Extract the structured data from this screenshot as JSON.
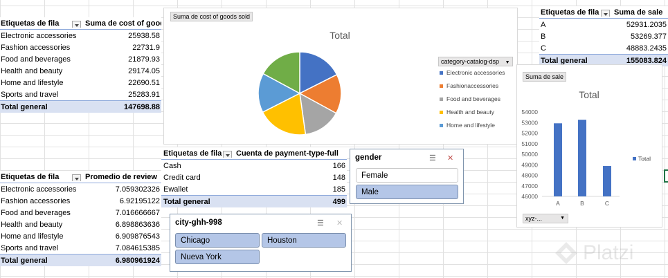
{
  "pivot_cost": {
    "header_row": "Etiquetas de fila",
    "header_value": "Suma de cost of goods",
    "rows": [
      {
        "label": "Electronic accessories",
        "value": "25938.58"
      },
      {
        "label": "Fashion accessories",
        "value": "22731.9"
      },
      {
        "label": "Food and beverages",
        "value": "21879.93"
      },
      {
        "label": "Health and beauty",
        "value": "29174.05"
      },
      {
        "label": "Home and lifestyle",
        "value": "22690.51"
      },
      {
        "label": "Sports and travel",
        "value": "25283.91"
      }
    ],
    "total_label": "Total general",
    "total_value": "147698.88"
  },
  "pivot_review": {
    "header_row": "Etiquetas de fila",
    "header_value": "Promedio de review",
    "rows": [
      {
        "label": "Electronic accessories",
        "value": "7.059302326"
      },
      {
        "label": "Fashion accessories",
        "value": "6.92195122"
      },
      {
        "label": "Food and beverages",
        "value": "7.016666667"
      },
      {
        "label": "Health and beauty",
        "value": "6.898863636"
      },
      {
        "label": "Home and lifestyle",
        "value": "6.909876543"
      },
      {
        "label": "Sports and travel",
        "value": "7.084615385"
      }
    ],
    "total_label": "Total general",
    "total_value": "6.980961924"
  },
  "pivot_payment": {
    "header_row": "Etiquetas de fila",
    "header_value": "Cuenta de payment-type-full",
    "rows": [
      {
        "label": "Cash",
        "value": "166"
      },
      {
        "label": "Credit card",
        "value": "148"
      },
      {
        "label": "Ewallet",
        "value": "185"
      }
    ],
    "total_label": "Total general",
    "total_value": "499"
  },
  "pivot_sales": {
    "header_row": "Etiquetas de fila",
    "header_value": "Suma de sale",
    "rows": [
      {
        "label": "A",
        "value": "52931.2035"
      },
      {
        "label": "B",
        "value": "53269.377"
      },
      {
        "label": "C",
        "value": "48883.2435"
      }
    ],
    "total_label": "Total general",
    "total_value": "155083.824"
  },
  "pie_chart": {
    "field_button": "Suma de cost  of goods sold",
    "legend_filter": "category-catalog-dsp"
  },
  "bar_chart": {
    "field_button": "Suma de sale",
    "axis_filter": "xyz-..."
  },
  "slicer_gender": {
    "title": "gender",
    "options": [
      {
        "label": "Female",
        "selected": false
      },
      {
        "label": "Male",
        "selected": true
      }
    ]
  },
  "slicer_city": {
    "title": "city-ghh-998",
    "options": [
      {
        "label": "Chicago",
        "selected": true
      },
      {
        "label": "Houston",
        "selected": true
      },
      {
        "label": "Nueva York",
        "selected": true
      }
    ]
  },
  "watermark": "Platzi",
  "colors": {
    "header_border": "#8ea9db",
    "total_fill": "#d9e1f2",
    "slicer_selected": "#b4c6e7",
    "bar": "#4472c4"
  },
  "chart_data": [
    {
      "type": "pie",
      "title": "Total",
      "categories": [
        "Electronic accessories",
        "Fashion accessories",
        "Food and beverages",
        "Health and beauty",
        "Home and lifestyle",
        "Sports and travel"
      ],
      "legend_labels": [
        "Electronic accessories",
        "Fashionaccessories",
        "Food and beverages",
        "Health and beauty",
        "Home and lifestyle"
      ],
      "values": [
        25938.58,
        22731.9,
        21879.93,
        29174.05,
        22690.51,
        25283.91
      ],
      "colors": [
        "#4472c4",
        "#ed7d31",
        "#a5a5a5",
        "#ffc000",
        "#5b9bd5",
        "#70ad47"
      ],
      "legend_placement": "right"
    },
    {
      "type": "bar",
      "title": "Total",
      "categories": [
        "A",
        "B",
        "C"
      ],
      "series": [
        {
          "name": "Total",
          "values": [
            52931.2035,
            53269.377,
            48883.2435
          ]
        }
      ],
      "ylim": [
        46000,
        54000
      ],
      "yticks": [
        "54000",
        "53000",
        "52000",
        "51000",
        "50000",
        "49000",
        "48000",
        "47000",
        "46000"
      ],
      "grid": false,
      "legend_placement": "right"
    }
  ]
}
